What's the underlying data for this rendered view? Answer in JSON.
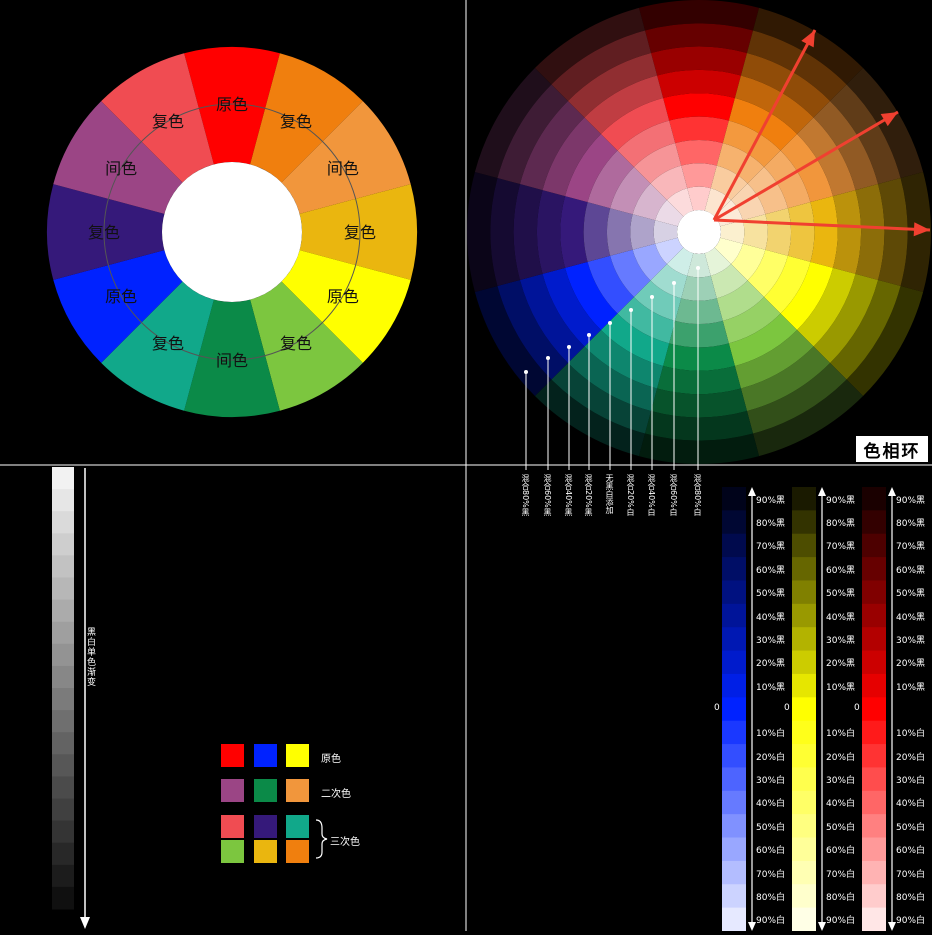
{
  "colors": {
    "red": "#ff0000",
    "red_orange": "#f26522",
    "orange": "#f7941d",
    "orange_light": "#f39a3c",
    "yellow_orange": "#eab60f",
    "yellow": "#ffff00",
    "yellow_green": "#7cc63f",
    "green": "#0b8a48",
    "blue_green": "#11a88a",
    "blue": "#0022ff",
    "blue_violet": "#35197a",
    "violet": "#9b4585",
    "red_violet": "#f04c52",
    "arrow": "#f04030",
    "background": "#000000"
  },
  "wheel_left": {
    "center_label": "",
    "segments": [
      {
        "label": "原色",
        "color": "#ff0000"
      },
      {
        "label": "复色",
        "color": "#f07f0e"
      },
      {
        "label": "间色",
        "color": "#f1963c"
      },
      {
        "label": "复色",
        "color": "#eab60f"
      },
      {
        "label": "原色",
        "color": "#ffff00"
      },
      {
        "label": "复色",
        "color": "#7cc63f"
      },
      {
        "label": "间色",
        "color": "#0b8a48"
      },
      {
        "label": "复色",
        "color": "#11a88a"
      },
      {
        "label": "原色",
        "color": "#0022ff"
      },
      {
        "label": "复色",
        "color": "#35197a"
      },
      {
        "label": "间色",
        "color": "#9b4585"
      },
      {
        "label": "复色",
        "color": "#f04c52"
      }
    ]
  },
  "wheel_right": {
    "title": "色相环",
    "hues": [
      "#ff0000",
      "#f07f0e",
      "#f1963c",
      "#eab60f",
      "#ffff00",
      "#7cc63f",
      "#0b8a48",
      "#11a88a",
      "#0022ff",
      "#35197a",
      "#9b4585",
      "#f04c52"
    ],
    "ring_labels": [
      "混合80%黑",
      "混合60%黑",
      "混合40%黑",
      "混合20%黑",
      "无黑白添加",
      "混合20%白",
      "混合40%白",
      "混合60%白",
      "混合80%白"
    ]
  },
  "grayscale": {
    "label": "黑白单色渐变",
    "steps": 20
  },
  "legend": {
    "rows": [
      {
        "label": "原色",
        "swatches": [
          "#ff0000",
          "#0022ff",
          "#ffff00"
        ]
      },
      {
        "label": "二次色",
        "swatches": [
          "#9b4585",
          "#0b8a48",
          "#f1963c"
        ]
      },
      {
        "label": "三次色",
        "swatches": [
          "#f04c52",
          "#35197a",
          "#11a88a"
        ]
      },
      {
        "label": "",
        "swatches": [
          "#7cc63f",
          "#eab60f",
          "#f07f0e"
        ]
      }
    ]
  },
  "tint_columns": {
    "labels": [
      "90%黑",
      "80%黑",
      "70%黑",
      "60%黑",
      "50%黑",
      "40%黑",
      "30%黑",
      "20%黑",
      "10%黑",
      "0",
      "10%白",
      "20%白",
      "30%白",
      "40%白",
      "50%白",
      "60%白",
      "70%白",
      "80%白",
      "90%白"
    ],
    "bases": [
      "#0022ff",
      "#ffff00",
      "#ff0000"
    ]
  }
}
